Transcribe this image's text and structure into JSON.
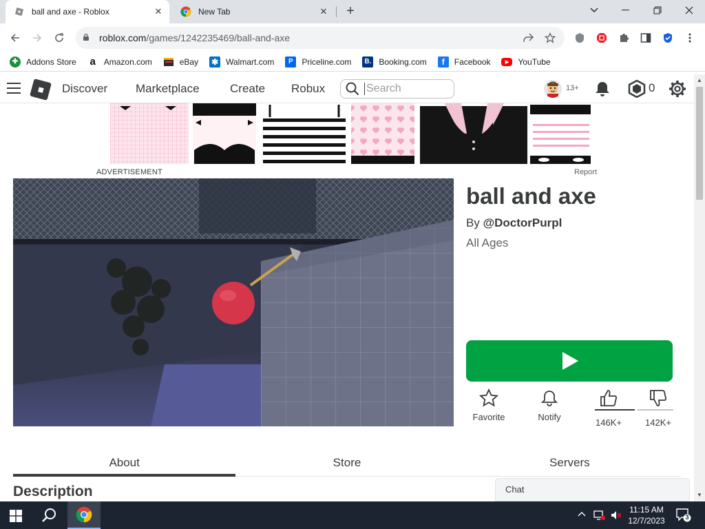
{
  "browser": {
    "tabs": [
      {
        "title": "ball and axe - Roblox"
      },
      {
        "title": "New Tab"
      }
    ],
    "address": {
      "host": "roblox.com",
      "path": "/games/1242235469/ball-and-axe"
    },
    "bookmarks": [
      {
        "label": "Addons Store",
        "color": "#1e8e3e",
        "glyph": "✚"
      },
      {
        "label": "Amazon.com",
        "color": "#111111",
        "glyph": "a"
      },
      {
        "label": "eBay",
        "color": "#e53238",
        "glyph": "▦"
      },
      {
        "label": "Walmart.com",
        "color": "#0071ce",
        "glyph": "✱"
      },
      {
        "label": "Priceline.com",
        "color": "#0068ef",
        "glyph": "P"
      },
      {
        "label": "Booking.com",
        "color": "#003580",
        "glyph": "B"
      },
      {
        "label": "Facebook",
        "color": "#1877f2",
        "glyph": "f"
      },
      {
        "label": "YouTube",
        "color": "#ff0000",
        "glyph": "▶"
      }
    ]
  },
  "header": {
    "nav": [
      "Discover",
      "Marketplace",
      "Create",
      "Robux"
    ],
    "search_placeholder": "Search",
    "age_badge": "13+",
    "robux": "0"
  },
  "ad": {
    "label": "ADVERTISEMENT",
    "report": "Report"
  },
  "game": {
    "title": "ball and axe",
    "by_prefix": "By ",
    "creator": "@DoctorPurpl",
    "age_rating": "All Ages",
    "actions": {
      "favorite": "Favorite",
      "notify": "Notify",
      "upvotes": "146K+",
      "downvotes": "142K+"
    },
    "vote_ratio": 0.507
  },
  "tabs": [
    "About",
    "Store",
    "Servers"
  ],
  "active_tab": "About",
  "description_heading": "Description",
  "chat_label": "Chat",
  "taskbar": {
    "time": "11:15 AM",
    "date": "12/7/2023",
    "notifications": "3"
  },
  "colors": {
    "play": "#00a241",
    "text": "#393b3d"
  }
}
